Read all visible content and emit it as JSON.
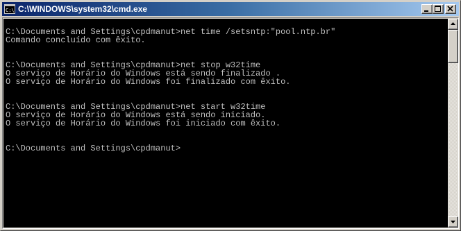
{
  "window": {
    "title": "C:\\WINDOWS\\system32\\cmd.exe",
    "icon": "cmd-app-icon",
    "controls": {
      "minimize_icon": "minimize-icon",
      "maximize_icon": "maximize-icon",
      "close_icon": "close-icon"
    }
  },
  "console": {
    "background_color": "#000000",
    "text_color": "#c0c0c0",
    "lines": [
      "C:\\Documents and Settings\\cpdmanut>net time /setsntp:\"pool.ntp.br\"",
      "Comando concluído com êxito.",
      "",
      "",
      "C:\\Documents and Settings\\cpdmanut>net stop w32time",
      "O serviço de Horário do Windows está sendo finalizado .",
      "O serviço de Horário do Windows foi finalizado com êxito.",
      "",
      "",
      "C:\\Documents and Settings\\cpdmanut>net start w32time",
      "O serviço de Horário do Windows está sendo iniciado.",
      "O serviço de Horário do Windows foi iniciado com êxito.",
      "",
      "",
      "C:\\Documents and Settings\\cpdmanut>"
    ]
  },
  "scrollbar": {
    "up_icon": "arrow-up-icon",
    "down_icon": "arrow-down-icon",
    "scroll_position": 0
  }
}
